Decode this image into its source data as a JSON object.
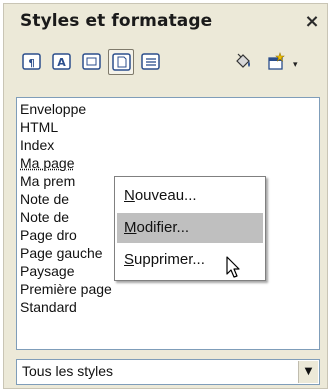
{
  "window": {
    "title": "Styles et formatage",
    "close_label": "×"
  },
  "toolbar": {
    "buttons": [
      {
        "icon": "paragraph-styles-icon"
      },
      {
        "icon": "character-styles-icon"
      },
      {
        "icon": "frame-styles-icon"
      },
      {
        "icon": "page-styles-icon",
        "pressed": true
      },
      {
        "icon": "list-styles-icon"
      },
      {
        "icon": "fill-format-mode-icon"
      },
      {
        "icon": "new-style-from-selection-icon"
      }
    ],
    "dropdown_glyph": "▾"
  },
  "styles_list": {
    "items": [
      {
        "label": "Enveloppe"
      },
      {
        "label": "HTML"
      },
      {
        "label": "Index"
      },
      {
        "label": "Ma page",
        "selected": true
      },
      {
        "label": "Ma prem"
      },
      {
        "label": "Note de"
      },
      {
        "label": "Note de"
      },
      {
        "label": "Page dro"
      },
      {
        "label": "Page gauche"
      },
      {
        "label": "Paysage"
      },
      {
        "label": "Première page"
      },
      {
        "label": "Standard"
      }
    ]
  },
  "context_menu": {
    "items": [
      {
        "label": "Nouveau...",
        "accel": "N",
        "rest": "ouveau..."
      },
      {
        "label": "Modifier...",
        "accel": "M",
        "rest": "odifier...",
        "hover": true
      },
      {
        "label": "Supprimer...",
        "accel": "S",
        "rest": "upprimer..."
      }
    ]
  },
  "filter": {
    "value": "Tous les styles",
    "arrow_glyph": "▼"
  }
}
